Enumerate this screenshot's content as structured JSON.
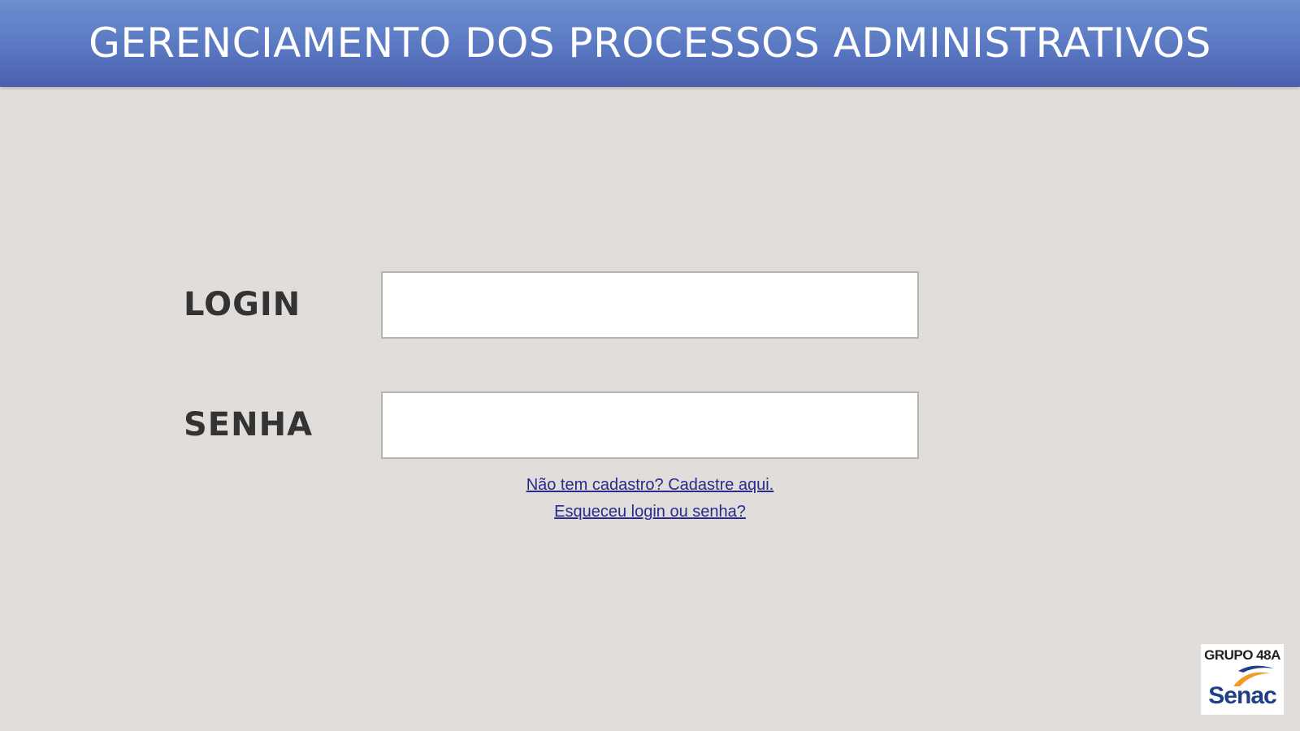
{
  "header": {
    "title": "GERENCIAMENTO DOS PROCESSOS ADMINISTRATIVOS"
  },
  "form": {
    "login_label": "LOGIN",
    "login_value": "",
    "senha_label": "SENHA",
    "senha_value": ""
  },
  "links": {
    "register": "Não tem cadastro? Cadastre aqui.",
    "forgot": "Esqueceu login ou senha?"
  },
  "logo": {
    "group_text": "GRUPO 48A",
    "brand_text": "Senac",
    "brand_color": "#1f3f86",
    "accent_color": "#f39a24"
  },
  "colors": {
    "header": "#5a78c2",
    "background": "#e0ddda",
    "link": "#2a2a8c"
  }
}
